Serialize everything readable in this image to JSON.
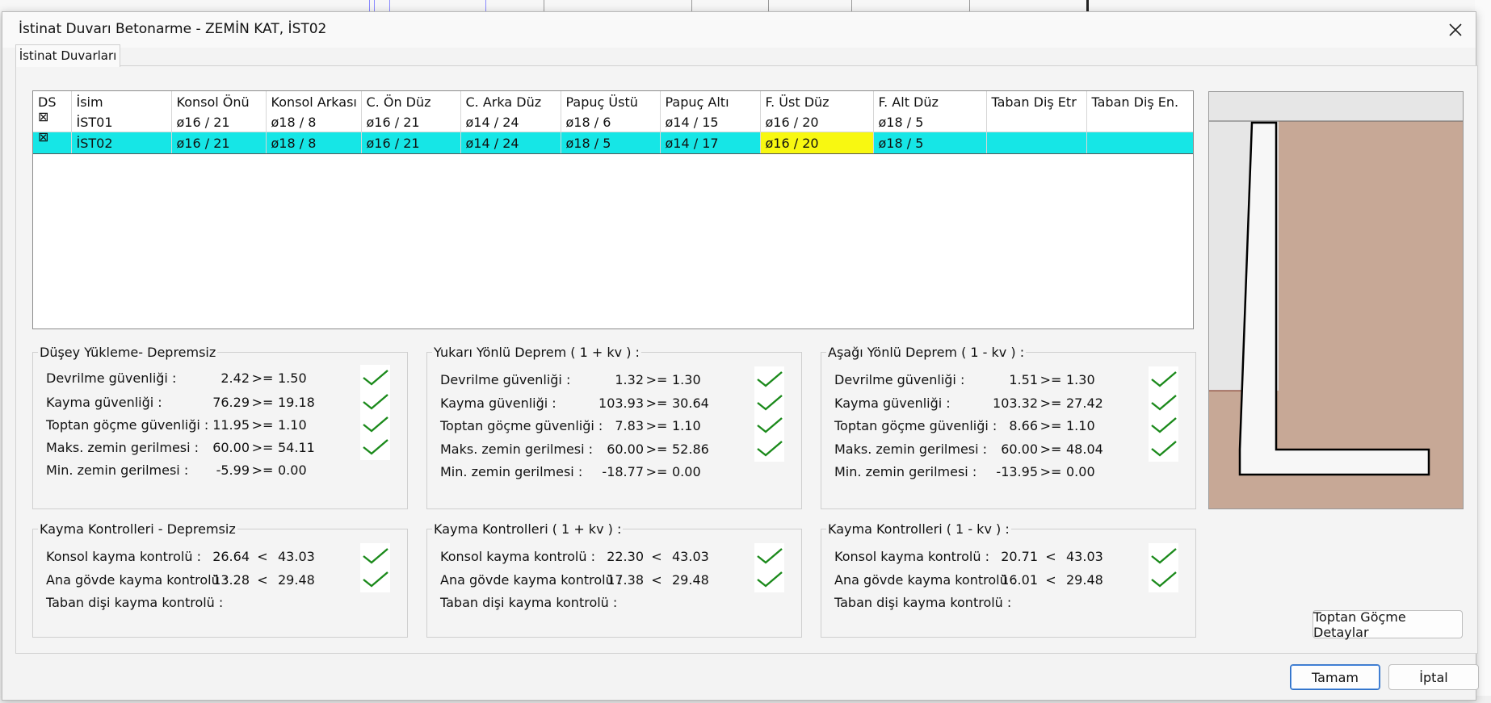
{
  "window": {
    "title": "İstinat Duvarı Betonarme - ZEMİN KAT, İST02",
    "close_icon": "close-icon"
  },
  "tab": {
    "label": "İstinat Duvarları"
  },
  "grid": {
    "columns": [
      "DS",
      "İsim",
      "Konsol Önü",
      "Konsol Arkası",
      "C. Ön Düz",
      "C. Arka Düz",
      "Papuç Üstü",
      "Papuç Altı",
      "F. Üst Düz",
      "F. Alt Düz",
      "Taban Diş Etr",
      "Taban Diş En."
    ],
    "ds_header_mark": "⊠",
    "rows": [
      {
        "ds": "",
        "name": "İST01",
        "cells": [
          "ø16 / 21",
          "ø18 / 8",
          "ø16 / 21",
          "ø14 / 24",
          "ø18 / 6",
          "ø14 / 15",
          "ø16 / 20",
          "ø18 / 5",
          "",
          ""
        ]
      },
      {
        "ds": "⊠",
        "name": "İST02",
        "cells": [
          "ø16 / 21",
          "ø18 / 8",
          "ø16 / 21",
          "ø14 / 24",
          "ø18 / 5",
          "ø14 / 17",
          "ø16 / 20",
          "ø18 / 5",
          "",
          ""
        ],
        "selected": true,
        "highlight_col": "F. Üst Düz"
      }
    ],
    "colors": {
      "selected_row": "#16e6e6",
      "highlight_cell": "#f8f811"
    }
  },
  "groups": [
    {
      "title": "Düşey Yükleme- Depremsiz",
      "rows": [
        {
          "label": "Devrilme güvenliği :",
          "value": "2.42",
          "op": ">=",
          "limit": "1.50",
          "ok": true
        },
        {
          "label": "Kayma güvenliği :",
          "value": "76.29",
          "op": ">=",
          "limit": "19.18",
          "ok": true
        },
        {
          "label": "Toptan göçme güvenliği :",
          "value": "11.95",
          "op": ">=",
          "limit": "1.10",
          "ok": true
        },
        {
          "label": "Maks. zemin gerilmesi :",
          "value": "60.00",
          "op": ">=",
          "limit": "54.11",
          "ok": true
        },
        {
          "label": "Min. zemin gerilmesi :",
          "value": "-5.99",
          "op": ">=",
          "limit": "0.00",
          "ok": false
        }
      ]
    },
    {
      "title": "Yukarı Yönlü Deprem ( 1 + kv ) :",
      "rows": [
        {
          "label": "Devrilme güvenliği :",
          "value": "1.32",
          "op": ">=",
          "limit": "1.30",
          "ok": true
        },
        {
          "label": "Kayma güvenliği :",
          "value": "103.93",
          "op": ">=",
          "limit": "30.64",
          "ok": true
        },
        {
          "label": "Toptan göçme güvenliği :",
          "value": "7.83",
          "op": ">=",
          "limit": "1.10",
          "ok": true
        },
        {
          "label": "Maks. zemin gerilmesi :",
          "value": "60.00",
          "op": ">=",
          "limit": "52.86",
          "ok": true
        },
        {
          "label": "Min. zemin gerilmesi :",
          "value": "-18.77",
          "op": ">=",
          "limit": "0.00",
          "ok": false
        }
      ]
    },
    {
      "title": "Aşağı Yönlü Deprem ( 1 - kv ) :",
      "rows": [
        {
          "label": "Devrilme güvenliği :",
          "value": "1.51",
          "op": ">=",
          "limit": "1.30",
          "ok": true
        },
        {
          "label": "Kayma güvenliği :",
          "value": "103.32",
          "op": ">=",
          "limit": "27.42",
          "ok": true
        },
        {
          "label": "Toptan göçme güvenliği :",
          "value": "8.66",
          "op": ">=",
          "limit": "1.10",
          "ok": true
        },
        {
          "label": "Maks. zemin gerilmesi :",
          "value": "60.00",
          "op": ">=",
          "limit": "48.04",
          "ok": true
        },
        {
          "label": "Min. zemin gerilmesi :",
          "value": "-13.95",
          "op": ">=",
          "limit": "0.00",
          "ok": false
        }
      ]
    },
    {
      "title": "Kayma Kontrolleri - Depremsiz",
      "rows": [
        {
          "label": "Konsol kayma kontrolü :",
          "value": "26.64",
          "op": "<",
          "limit": "43.03",
          "ok": true
        },
        {
          "label": "Ana gövde kayma kontrolü :",
          "value": "13.28",
          "op": "<",
          "limit": "29.48",
          "ok": true
        },
        {
          "label": "Taban dişi kayma kontrolü :",
          "value": "",
          "op": "",
          "limit": "",
          "ok": false
        }
      ]
    },
    {
      "title": "Kayma Kontrolleri ( 1 + kv ) :",
      "rows": [
        {
          "label": "Konsol kayma kontrolü :",
          "value": "22.30",
          "op": "<",
          "limit": "43.03",
          "ok": true
        },
        {
          "label": "Ana gövde kayma kontrolü :",
          "value": "17.38",
          "op": "<",
          "limit": "29.48",
          "ok": true
        },
        {
          "label": "Taban dişi kayma kontrolü :",
          "value": "",
          "op": "",
          "limit": "",
          "ok": false
        }
      ]
    },
    {
      "title": "Kayma Kontrolleri ( 1 - kv ) :",
      "rows": [
        {
          "label": "Konsol kayma kontrolü :",
          "value": "20.71",
          "op": "<",
          "limit": "43.03",
          "ok": true
        },
        {
          "label": "Ana gövde kayma kontrolü :",
          "value": "16.01",
          "op": "<",
          "limit": "29.48",
          "ok": true
        },
        {
          "label": "Taban dişi kayma kontrolü :",
          "value": "",
          "op": "",
          "limit": "",
          "ok": false
        }
      ]
    }
  ],
  "preview": {
    "icon": "retaining-wall-section",
    "soil_color": "#c7a896",
    "wall_color": "#f7f7f7"
  },
  "buttons": {
    "details": "Toptan Göçme Detaylar",
    "ok": "Tamam",
    "cancel": "İptal"
  },
  "check_icon": "check-icon"
}
